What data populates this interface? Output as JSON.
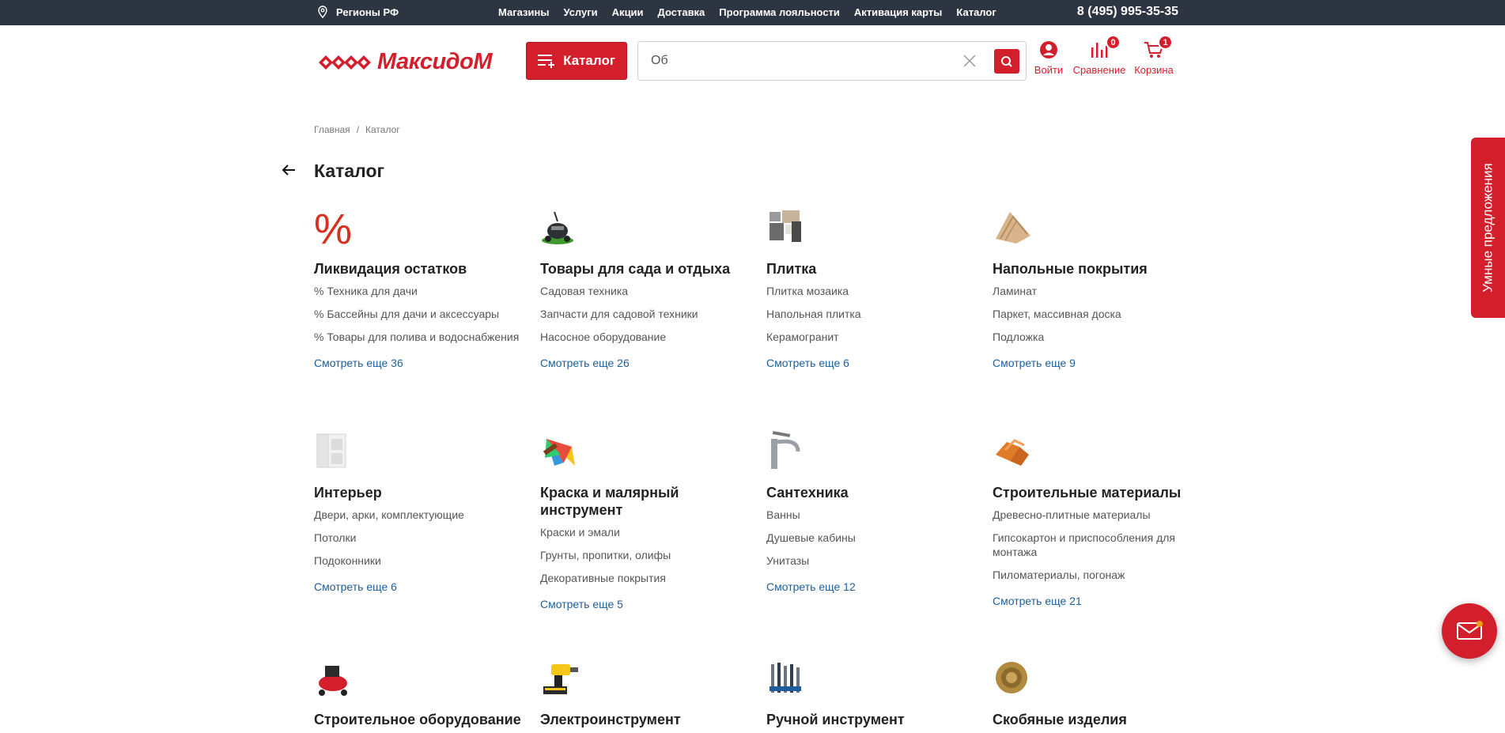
{
  "topbar": {
    "region": "Регионы РФ",
    "nav": [
      "Магазины",
      "Услуги",
      "Акции",
      "Доставка",
      "Программа лояльности",
      "Активация карты",
      "Каталог"
    ],
    "phone": "8 (495) 995-35-35"
  },
  "header": {
    "logo_text": "МаксидоМ",
    "catalog_button": "Каталог",
    "search_value": "Об",
    "login_label": "Войти",
    "compare_label": "Сравнение",
    "compare_count": "0",
    "cart_label": "Корзина",
    "cart_count": "1"
  },
  "breadcrumb": {
    "home": "Главная",
    "sep": "/",
    "current": "Каталог"
  },
  "page_title": "Каталог",
  "categories": [
    {
      "title": "Ликвидация остатков",
      "subs": [
        "% Техника для дачи",
        "% Бассейны для дачи и аксессуары",
        "% Товары для полива и водоснабжения"
      ],
      "more": "Смотреть еще 36",
      "icon": "percent-icon"
    },
    {
      "title": "Товары для сада и отдыха",
      "subs": [
        "Садовая техника",
        "Запчасти для садовой техники",
        "Насосное оборудование"
      ],
      "more": "Смотреть еще 26",
      "icon": "lawn-mower-icon"
    },
    {
      "title": "Плитка",
      "subs": [
        "Плитка мозаика",
        "Напольная плитка",
        "Керамогранит"
      ],
      "more": "Смотреть еще 6",
      "icon": "tile-icon"
    },
    {
      "title": "Напольные покрытия",
      "subs": [
        "Ламинат",
        "Паркет, массивная доска",
        "Подложка"
      ],
      "more": "Смотреть еще 9",
      "icon": "laminate-icon"
    },
    {
      "title": "Интерьер",
      "subs": [
        "Двери, арки, комплектующие",
        "Потолки",
        "Подоконники"
      ],
      "more": "Смотреть еще 6",
      "icon": "door-icon"
    },
    {
      "title": "Краска и малярный инструмент",
      "subs": [
        "Краски и эмали",
        "Грунты, пропитки, олифы",
        "Декоративные покрытия"
      ],
      "more": "Смотреть еще 5",
      "icon": "paint-icon"
    },
    {
      "title": "Сантехника",
      "subs": [
        "Ванны",
        "Душевые кабины",
        "Унитазы"
      ],
      "more": "Смотреть еще 12",
      "icon": "faucet-icon"
    },
    {
      "title": "Строительные материалы",
      "subs": [
        "Древесно-плитные материалы",
        "Гипсокартон и приспособления для монтажа",
        "Пиломатериалы, погонаж"
      ],
      "more": "Смотреть еще 21",
      "icon": "bricks-icon"
    },
    {
      "title": "Строительное оборудование",
      "icon": "compressor-icon"
    },
    {
      "title": "Электроинструмент",
      "icon": "drill-icon"
    },
    {
      "title": "Ручной инструмент",
      "icon": "hand-tools-icon"
    },
    {
      "title": "Скобяные изделия",
      "icon": "door-knob-icon"
    }
  ],
  "smart_offers": "Умные предложения",
  "colors": {
    "brand": "#d31f2c",
    "topbar": "#2e3542",
    "link": "#1e5e9a"
  }
}
